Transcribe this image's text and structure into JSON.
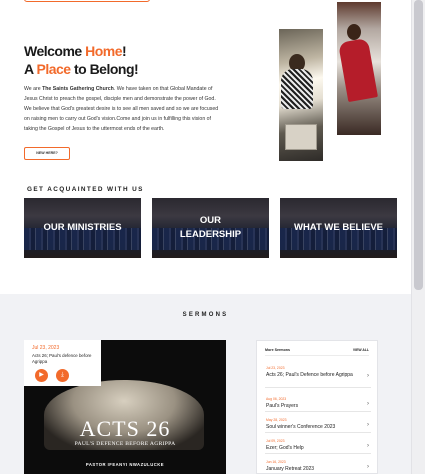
{
  "hero": {
    "title_line1_a": "Welcome ",
    "title_line1_b": "Home",
    "title_line1_c": "!",
    "title_line2_a": "A ",
    "title_line2_b": "Place",
    "title_line2_c": " to Belong!",
    "intro_prefix": "We are ",
    "intro_church": "The Saints Gathering Church",
    "intro_rest": ". We have taken on that Global Mandate of Jesus Christ to preach the gospel, disciple men and demonstrate the power of God. We believe that God's greatest desire is to see all men saved and so we are focused on raising men to carry out God's vision.Come and join us in fulfilling this vision of taking the Gospel of Jesus to the uttermost ends of the earth.",
    "cta_label": "NEW HERE?"
  },
  "acquainted": {
    "heading": "GET ACQUAINTED WITH US",
    "cards": [
      {
        "label": "OUR MINISTRIES"
      },
      {
        "label_line1": "OUR",
        "label_line2": "LEADERSHIP"
      },
      {
        "label": "WHAT WE BELIEVE"
      }
    ]
  },
  "sermons": {
    "heading": "SERMONS",
    "featured": {
      "date": "Jul 23, 2023",
      "title": "Acts 26; Paul's defence before Agrippa",
      "play_icon": "play-icon",
      "download_icon": "download-icon",
      "art_title": "ACTS 26",
      "art_subtitle": "PAUL'S DEFENCE BEFORE AGRIPPA",
      "art_pastor": "PASTOR IFEANYI NWAZULUCKE"
    },
    "more": {
      "header": "More Sermons",
      "view_all": "VIEW ALL",
      "items": [
        {
          "date": "Jul 23, 2023",
          "title": "Acts 26; Paul's Defence before Agrippa"
        },
        {
          "date": "Aug 06, 2023",
          "title": "Paul's Prayers"
        },
        {
          "date": "May 28, 2023",
          "title": "Soul winner's Conference 2023"
        },
        {
          "date": "Jul 09, 2023",
          "title": "Ezer; God's Help"
        },
        {
          "date": "Jun 16, 2023",
          "title": "January Retreat 2023"
        }
      ]
    }
  }
}
